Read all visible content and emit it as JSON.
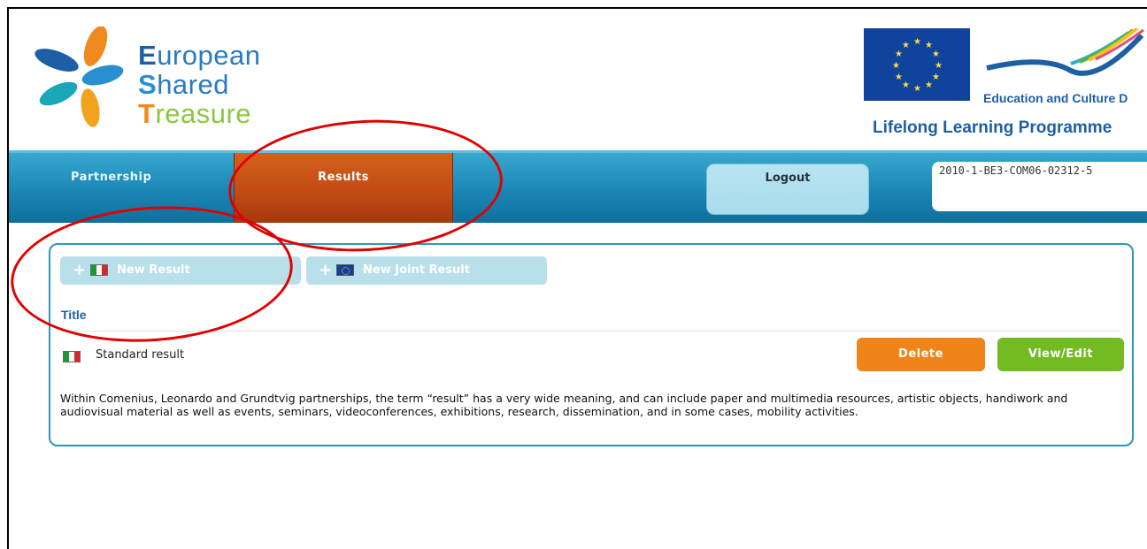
{
  "logo": {
    "line1_cap": "E",
    "line1_rest": "uropean",
    "line2_cap": "S",
    "line2_rest": "hared",
    "line3_cap": "T",
    "line3_rest": "reasure"
  },
  "llp": {
    "department": "Education and Culture D",
    "programme": "Lifelong Learning Programme"
  },
  "nav": {
    "partnership": "Partnership",
    "results": "Results",
    "logout": "Logout",
    "project_id": "2010-1-BE3-COM06-02312-5"
  },
  "panel": {
    "new_result": "New Result",
    "new_joint_result": "New Joint Result",
    "plus": "+",
    "title_header": "Title",
    "rows": [
      {
        "title": "Standard result",
        "delete": "Delete",
        "view_edit": "View/Edit"
      }
    ],
    "description": "Within Comenius, Leonardo and Grundtvig partnerships, the term “result” has a very wide meaning, and can include paper and multimedia resources, artistic objects, handiwork and audiovisual material as well as events, seminars, videoconferences, exhibitions, research, dissemination, and in some cases, mobility activities."
  },
  "colors": {
    "nav_blue": "#1a86b5",
    "results_tab": "#c14a13",
    "delete_button": "#f08418",
    "view_button": "#72bb23",
    "annotation_red": "#e00000",
    "flag_italy": [
      "#1b9a3a",
      "#ffffff",
      "#d8262d"
    ]
  }
}
